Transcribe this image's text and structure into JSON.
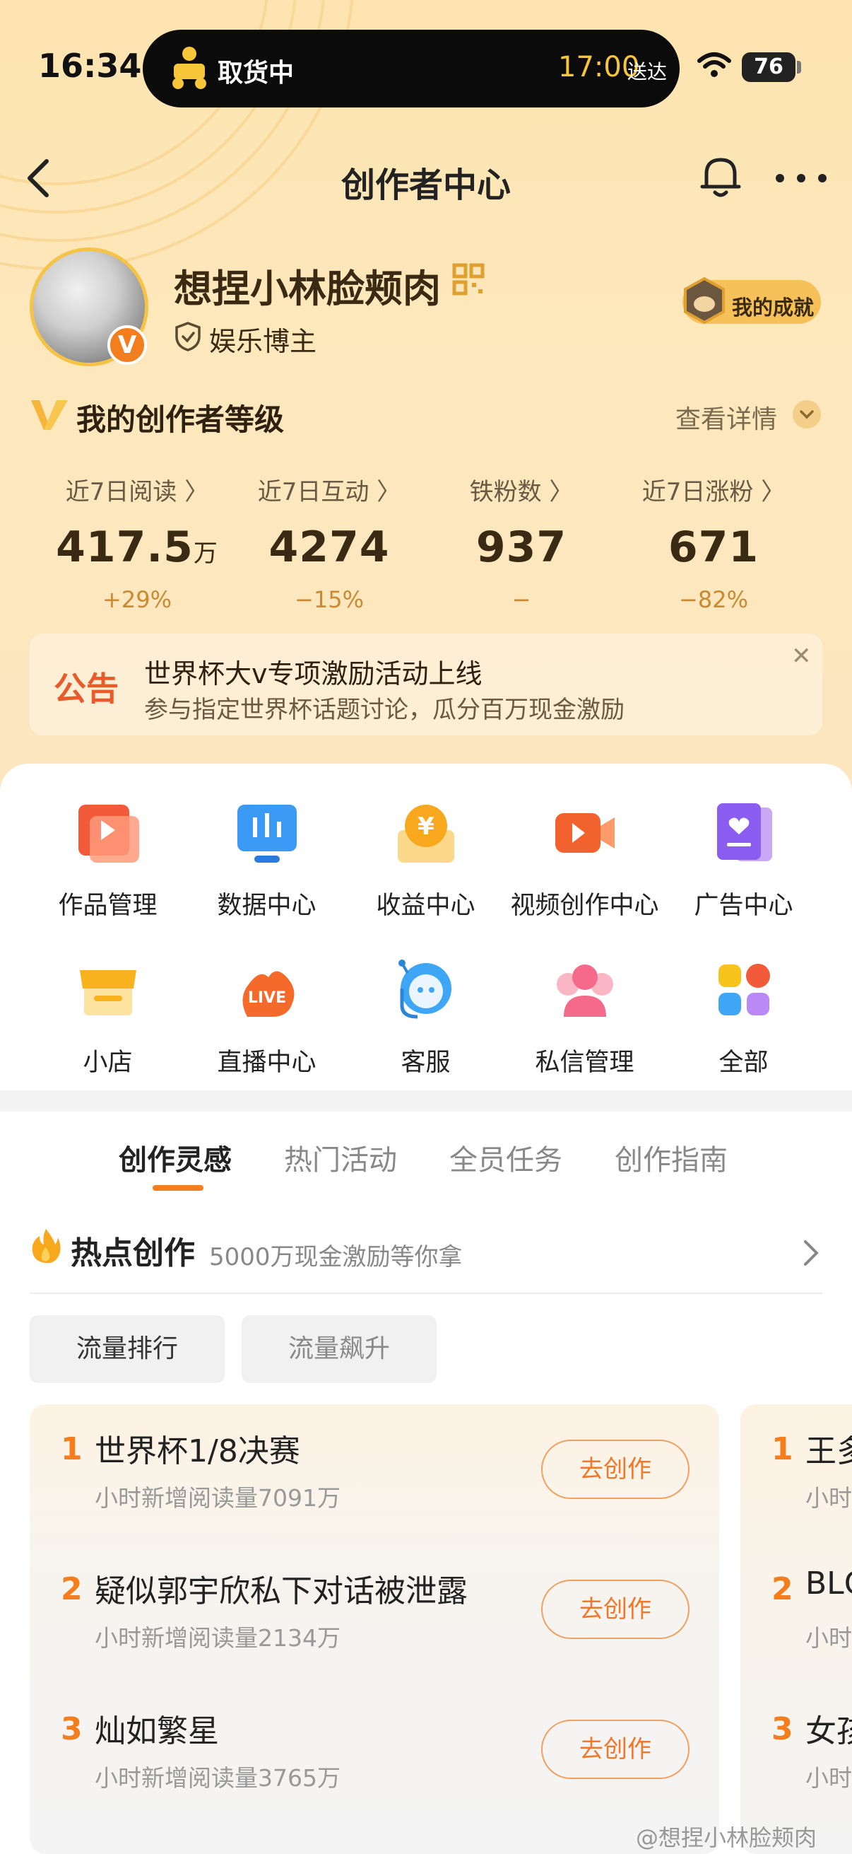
{
  "status_bar": {
    "time": "16:34",
    "island_status": "取货中",
    "island_eta": "17:00",
    "island_eta_suffix": "送达",
    "battery": "76"
  },
  "nav": {
    "title": "创作者中心",
    "icons": [
      "back-icon",
      "bell-icon",
      "more-icon"
    ]
  },
  "profile": {
    "username": "想捏小林脸颊肉",
    "role": "娱乐博主",
    "verified_badge": "V",
    "achievement_label": "我的成就"
  },
  "level": {
    "title": "我的创作者等级",
    "details_label": "查看详情"
  },
  "stats": [
    {
      "label": "近7日阅读 〉",
      "value": "417.5",
      "unit": "万",
      "change": "+29%"
    },
    {
      "label": "近7日互动 〉",
      "value": "4274",
      "unit": "",
      "change": "−15%"
    },
    {
      "label": "铁粉数 〉",
      "value": "937",
      "unit": "",
      "change": "−"
    },
    {
      "label": "近7日涨粉 〉",
      "value": "671",
      "unit": "",
      "change": "−82%"
    }
  ],
  "announcement": {
    "tag": "公告",
    "title": "世界杯大v专项激励活动上线",
    "subtitle": "参与指定世界杯话题讨论，瓜分百万现金激励",
    "close": "✕"
  },
  "tools": [
    {
      "label": "作品管理",
      "icon": "works-icon"
    },
    {
      "label": "数据中心",
      "icon": "data-icon"
    },
    {
      "label": "收益中心",
      "icon": "income-icon"
    },
    {
      "label": "视频创作中心",
      "icon": "video-icon"
    },
    {
      "label": "广告中心",
      "icon": "ad-icon"
    },
    {
      "label": "小店",
      "icon": "shop-icon"
    },
    {
      "label": "直播中心",
      "icon": "live-icon"
    },
    {
      "label": "客服",
      "icon": "service-icon"
    },
    {
      "label": "私信管理",
      "icon": "message-icon"
    },
    {
      "label": "全部",
      "icon": "all-icon"
    }
  ],
  "tabs": [
    {
      "label": "创作灵感",
      "active": true
    },
    {
      "label": "热门活动",
      "active": false
    },
    {
      "label": "全员任务",
      "active": false
    },
    {
      "label": "创作指南",
      "active": false
    }
  ],
  "hot": {
    "title": "热点创作",
    "subtitle": "5000万现金激励等你拿"
  },
  "chips": [
    "流量排行",
    "流量飙升"
  ],
  "ranking": [
    {
      "rank": "1",
      "title": "世界杯1/8决赛",
      "subtitle": "小时新增阅读量7091万",
      "button": "去创作"
    },
    {
      "rank": "2",
      "title": "疑似郭宇欣私下对话被泄露",
      "subtitle": "小时新增阅读量2134万",
      "button": "去创作"
    },
    {
      "rank": "3",
      "title": "灿如繁星",
      "subtitle": "小时新增阅读量3765万",
      "button": "去创作"
    }
  ],
  "ranking_partial": [
    {
      "rank": "1",
      "title": "王多",
      "subtitle": "小时"
    },
    {
      "rank": "2",
      "title": "BLC",
      "subtitle": "小时"
    },
    {
      "rank": "3",
      "title": "女孩",
      "subtitle": "小时"
    }
  ],
  "watermark": "@想捏小林脸颊肉",
  "colors": {
    "accent": "#f47d1d",
    "header_bg": "#fde4b0",
    "change_text": "#c98a33"
  }
}
